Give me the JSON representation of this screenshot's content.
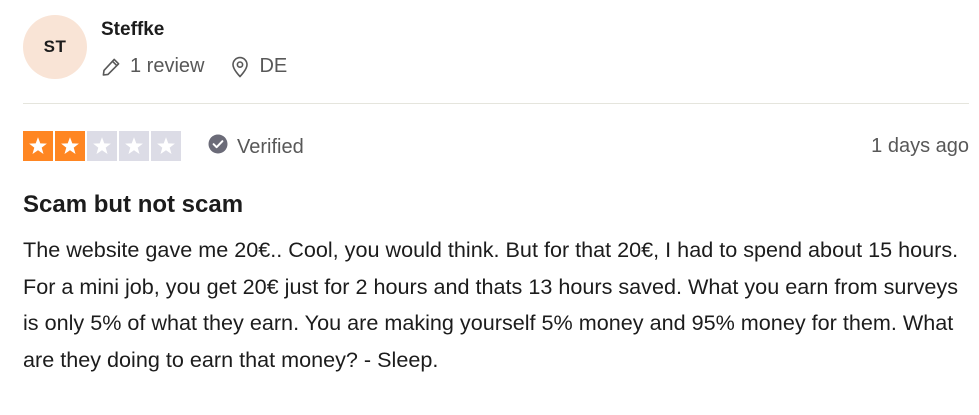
{
  "reviewer": {
    "initials": "ST",
    "name": "Steffke",
    "review_count": "1 review",
    "country": "DE",
    "avatar_color": "#f9e4d6"
  },
  "review": {
    "rating": 2,
    "max_rating": 5,
    "verified_label": "Verified",
    "date": "1 days ago",
    "title": "Scam but not scam",
    "body": "The website gave me 20€.. Cool, you would think. But for that 20€, I had to spend about 15 hours. For a mini job, you get 20€ just for 2 hours and thats 13 hours saved. What you earn from surveys is only 5% of what they earn. You are making yourself 5% money and 95% money for them. What are they doing to earn that money? - Sleep."
  },
  "colors": {
    "star_filled": "#ff8622",
    "star_empty": "#dcdce6",
    "text_primary": "#1c1c1c",
    "text_secondary": "#585858",
    "divider": "#e5e5dd"
  },
  "icons": {
    "review_count": "pencil-icon",
    "country": "location-pin-icon",
    "verified": "checkmark-circle-icon",
    "rating": "star-icon"
  }
}
